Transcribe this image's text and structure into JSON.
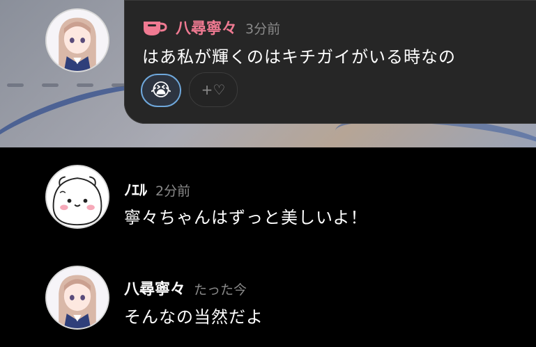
{
  "comments": [
    {
      "name": "八尋寧々",
      "time": "3分前",
      "text": "はあ私が輝くのはキチガイがいる時なの",
      "name_color": "#f07a92",
      "reactions": [
        {
          "emoji": "😭",
          "selected": true
        },
        {
          "add_label": "+♡"
        }
      ]
    },
    {
      "name": "ﾉｴﾙ",
      "time": "2分前",
      "text": "寧々ちゃんはずっと美しいよ！"
    },
    {
      "name": "八尋寧々",
      "time": "たった今",
      "text": "そんなの当然だよ"
    }
  ],
  "colors": {
    "highlight_bubble": "#262626",
    "background": "#000000",
    "timestamp": "#8a8a8a",
    "reaction_border_selected": "#6fa8dc"
  },
  "icons": [
    "teacup-icon",
    "crying-face-emoji",
    "add-heart-icon"
  ]
}
